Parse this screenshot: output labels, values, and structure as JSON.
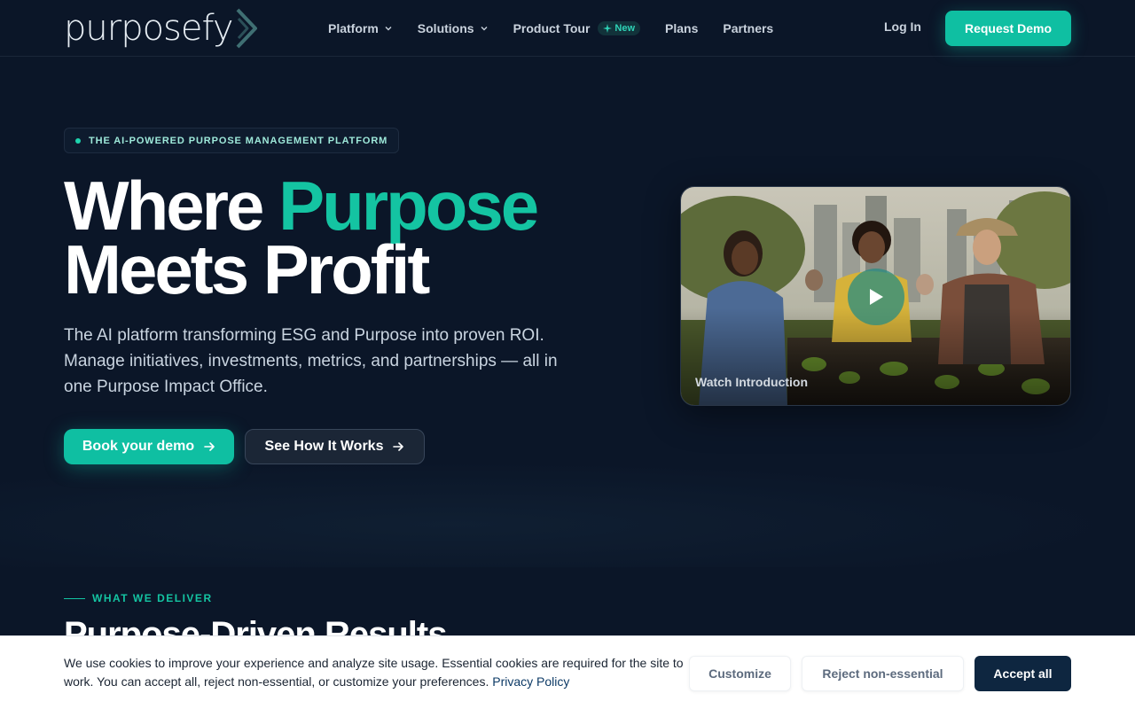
{
  "brand": {
    "logo_text": "purposefy",
    "accent_color": "#14c4a2",
    "background_color": "#0b1628"
  },
  "nav": {
    "items": [
      {
        "label": "Platform",
        "icon": "chevron-down-icon"
      },
      {
        "label": "Solutions",
        "icon": "chevron-down-icon"
      },
      {
        "label": "Product Tour",
        "badge": "New",
        "badge_icon": "sparkle-icon"
      },
      {
        "label": "Plans"
      },
      {
        "label": "Partners"
      }
    ],
    "login_label": "Log In",
    "request_demo_label": "Request Demo"
  },
  "hero": {
    "eyebrow": "THE AI-POWERED PURPOSE MANAGEMENT PLATFORM",
    "headline_part1": "Where ",
    "headline_accent": "Purpose",
    "headline_line2": "Meets Profit",
    "subtext": "The AI platform transforming ESG and Purpose into proven ROI. Manage initiatives, investments, metrics, and partnerships — all in one Purpose Impact Office.",
    "primary_cta": "Book your demo",
    "secondary_cta": "See How It Works",
    "video_label": "Watch Introduction"
  },
  "deliver": {
    "eyebrow": "WHAT WE DELIVER",
    "title": "Purpose-Driven Results"
  },
  "cookie": {
    "text": "We use cookies to improve your experience and analyze site usage. Essential cookies are required for the site to work. You can accept all, reject non-essential, or customize your preferences. ",
    "link": "Privacy Policy",
    "customize": "Customize",
    "reject": "Reject non-essential",
    "accept": "Accept all"
  }
}
